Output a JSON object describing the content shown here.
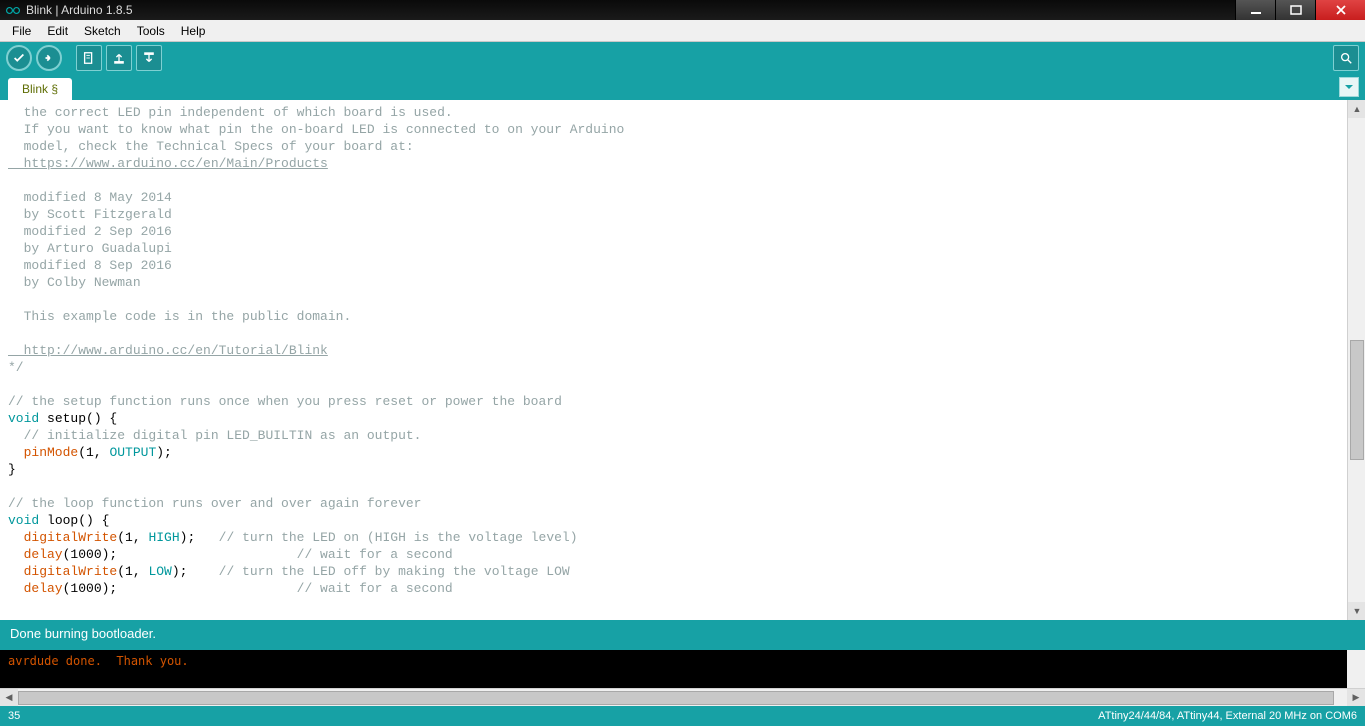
{
  "window": {
    "title": "Blink | Arduino 1.8.5"
  },
  "menu": {
    "file": "File",
    "edit": "Edit",
    "sketch": "Sketch",
    "tools": "Tools",
    "help": "Help"
  },
  "tab": {
    "name": "Blink §"
  },
  "code": {
    "l1": "  the correct LED pin independent of which board is used.",
    "l2": "  If you want to know what pin the on-board LED is connected to on your Arduino",
    "l3": "  model, check the Technical Specs of your board at:",
    "l4": "  https://www.arduino.cc/en/Main/Products",
    "l5": "",
    "l6": "  modified 8 May 2014",
    "l7": "  by Scott Fitzgerald",
    "l8": "  modified 2 Sep 2016",
    "l9": "  by Arturo Guadalupi",
    "l10": "  modified 8 Sep 2016",
    "l11": "  by Colby Newman",
    "l12": "",
    "l13": "  This example code is in the public domain.",
    "l14": "",
    "l15": "  http://www.arduino.cc/en/Tutorial/Blink",
    "l16": "*/",
    "l17": "",
    "l18": "// the setup function runs once when you press reset or power the board",
    "kw_void1": "void",
    "fn_setup": " setup",
    "paren1": "() {",
    "l20": "  // initialize digital pin LED_BUILTIN as an output.",
    "fn_pinmode": "  pinMode",
    "pm_args_a": "(1, ",
    "pm_output": "OUTPUT",
    "pm_args_b": ");",
    "l22": "}",
    "l23": "",
    "l24": "// the loop function runs over and over again forever",
    "kw_void2": "void",
    "fn_loop": " loop",
    "paren2": "() {",
    "fn_dw1": "  digitalWrite",
    "dw1_a": "(1, ",
    "dw1_high": "HIGH",
    "dw1_b": ");   ",
    "dw1_c": "// turn the LED on (HIGH is the voltage level)",
    "fn_delay1": "  delay",
    "delay1_a": "(1000);                       ",
    "delay1_c": "// wait for a second",
    "fn_dw2": "  digitalWrite",
    "dw2_a": "(1, ",
    "dw2_low": "LOW",
    "dw2_b": ");    ",
    "dw2_c": "// turn the LED off by making the voltage LOW",
    "fn_delay2": "  delay",
    "delay2_a": "(1000);                       ",
    "delay2_c": "// wait for a second"
  },
  "status": {
    "message": "Done burning bootloader."
  },
  "console": {
    "line1": "avrdude done.  Thank you."
  },
  "footer": {
    "line": "35",
    "board": "ATtiny24/44/84, ATtiny44, External 20 MHz on COM6"
  }
}
